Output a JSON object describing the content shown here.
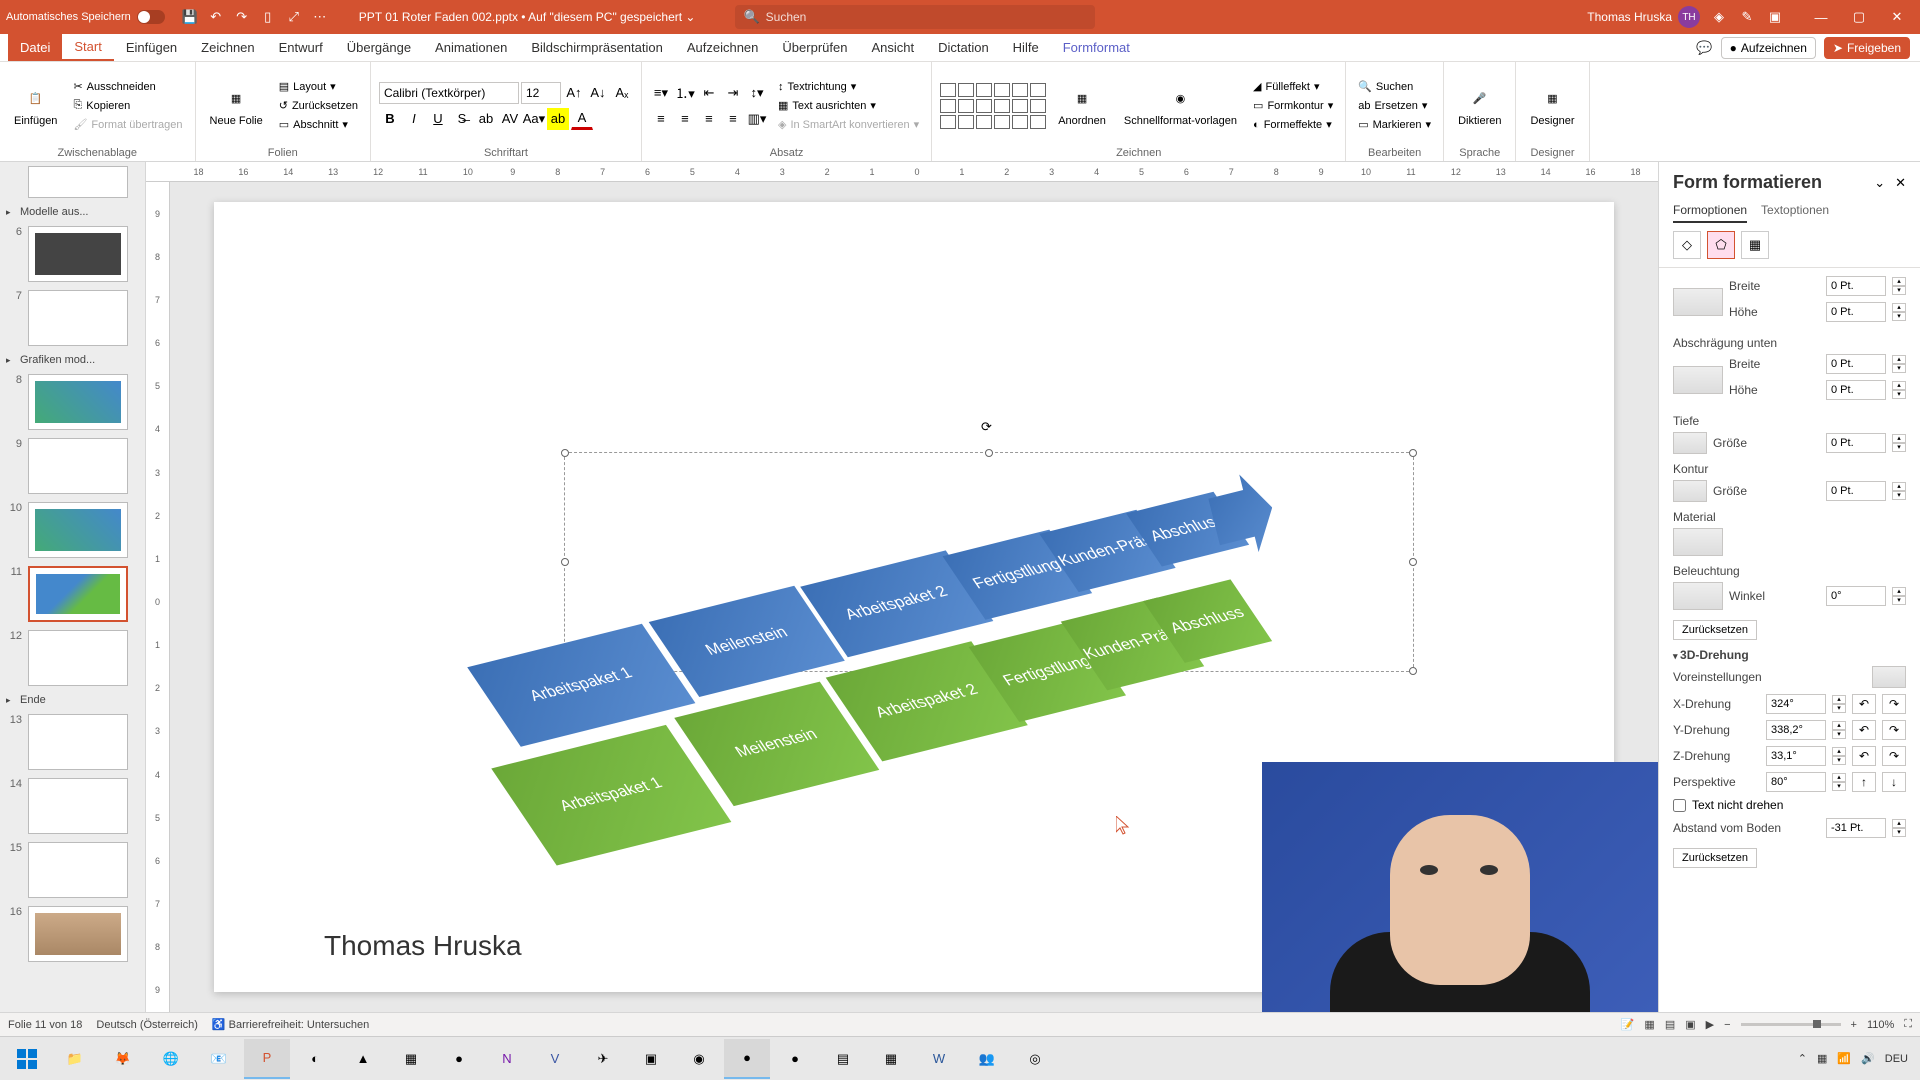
{
  "titlebar": {
    "autosave": "Automatisches Speichern",
    "filename": "PPT 01 Roter Faden 002.pptx • Auf \"diesem PC\" gespeichert ⌄",
    "search_placeholder": "Suchen",
    "user_name": "Thomas Hruska",
    "user_initials": "TH"
  },
  "tabs": {
    "file": "Datei",
    "items": [
      "Start",
      "Einfügen",
      "Zeichnen",
      "Entwurf",
      "Übergänge",
      "Animationen",
      "Bildschirmpräsentation",
      "Aufzeichnen",
      "Überprüfen",
      "Ansicht",
      "Dictation",
      "Hilfe",
      "Formformat"
    ],
    "active_index": 0,
    "record": "Aufzeichnen",
    "share": "Freigeben"
  },
  "ribbon": {
    "paste": "Einfügen",
    "cut": "Ausschneiden",
    "copy": "Kopieren",
    "format_painter": "Format übertragen",
    "clipboard": "Zwischenablage",
    "new_slide": "Neue Folie",
    "layout": "Layout",
    "reset_slide": "Zurücksetzen",
    "section": "Abschnitt",
    "slides": "Folien",
    "font_name": "Calibri (Textkörper)",
    "font_size": "12",
    "font_group": "Schriftart",
    "paragraph": "Absatz",
    "text_direction": "Textrichtung",
    "align_text": "Text ausrichten",
    "smartart": "In SmartArt konvertieren",
    "arrange": "Anordnen",
    "quickstyles": "Schnellformat-vorlagen",
    "fill": "Fülleffekt",
    "outline": "Formkontur",
    "effects": "Formeffekte",
    "drawing": "Zeichnen",
    "find": "Suchen",
    "replace": "Ersetzen",
    "select": "Markieren",
    "editing": "Bearbeiten",
    "dictate": "Diktieren",
    "voice": "Sprache",
    "designer": "Designer",
    "designer_g": "Designer"
  },
  "thumbnails": {
    "sections": [
      {
        "title": "Modelle aus...",
        "slides": [
          6,
          7
        ]
      },
      {
        "title": "Grafiken mod...",
        "slides": [
          8,
          9,
          10,
          11,
          12
        ]
      },
      {
        "title": "Ende",
        "slides": [
          13,
          14,
          15,
          16
        ]
      }
    ],
    "active": 11
  },
  "slide": {
    "author": "Thomas Hruska",
    "blocks_blue": [
      "Arbeitspaket 1",
      "Meilenstein",
      "Arbeitspaket 2",
      "Fertigstllung",
      "Kunden-Präsi",
      "Abschluss"
    ],
    "blocks_green": [
      "Arbeitspaket 1",
      "Meilenstein",
      "Arbeitspaket 2",
      "Fertigstllung",
      "Kunden-Präsi",
      "Abschluss"
    ]
  },
  "ruler_h": [
    "18",
    "16",
    "14",
    "13",
    "12",
    "11",
    "10",
    "9",
    "8",
    "7",
    "6",
    "5",
    "4",
    "3",
    "2",
    "1",
    "0",
    "1",
    "2",
    "3",
    "4",
    "5",
    "6",
    "7",
    "8",
    "9",
    "10",
    "11",
    "12",
    "13",
    "14",
    "16",
    "18"
  ],
  "ruler_v": [
    "9",
    "8",
    "7",
    "6",
    "5",
    "4",
    "3",
    "2",
    "1",
    "0",
    "1",
    "2",
    "3",
    "4",
    "5",
    "6",
    "7",
    "8",
    "9"
  ],
  "pane": {
    "title": "Form formatieren",
    "tab1": "Formoptionen",
    "tab2": "Textoptionen",
    "bevel_width": "Breite",
    "bevel_height": "Höhe",
    "bevel_bottom": "Abschrägung unten",
    "depth": "Tiefe",
    "size": "Größe",
    "contour": "Kontur",
    "material": "Material",
    "lighting": "Beleuchtung",
    "angle": "Winkel",
    "reset": "Zurücksetzen",
    "rotation3d": "3D-Drehung",
    "presets": "Voreinstellungen",
    "xrot": "X-Drehung",
    "yrot": "Y-Drehung",
    "zrot": "Z-Drehung",
    "perspective": "Perspektive",
    "keeptext": "Text nicht drehen",
    "distance": "Abstand vom Boden",
    "v_zero_pt": "0 Pt.",
    "v_xrot": "324°",
    "v_yrot": "338,2°",
    "v_zrot": "33,1°",
    "v_persp": "80°",
    "v_angle": "0°",
    "v_dist": "-31 Pt."
  },
  "status": {
    "slide_info": "Folie 11 von 18",
    "lang": "Deutsch (Österreich)",
    "access": "Barrierefreiheit: Untersuchen",
    "zoom": "110%"
  },
  "tray": {
    "lang": "DEU"
  }
}
